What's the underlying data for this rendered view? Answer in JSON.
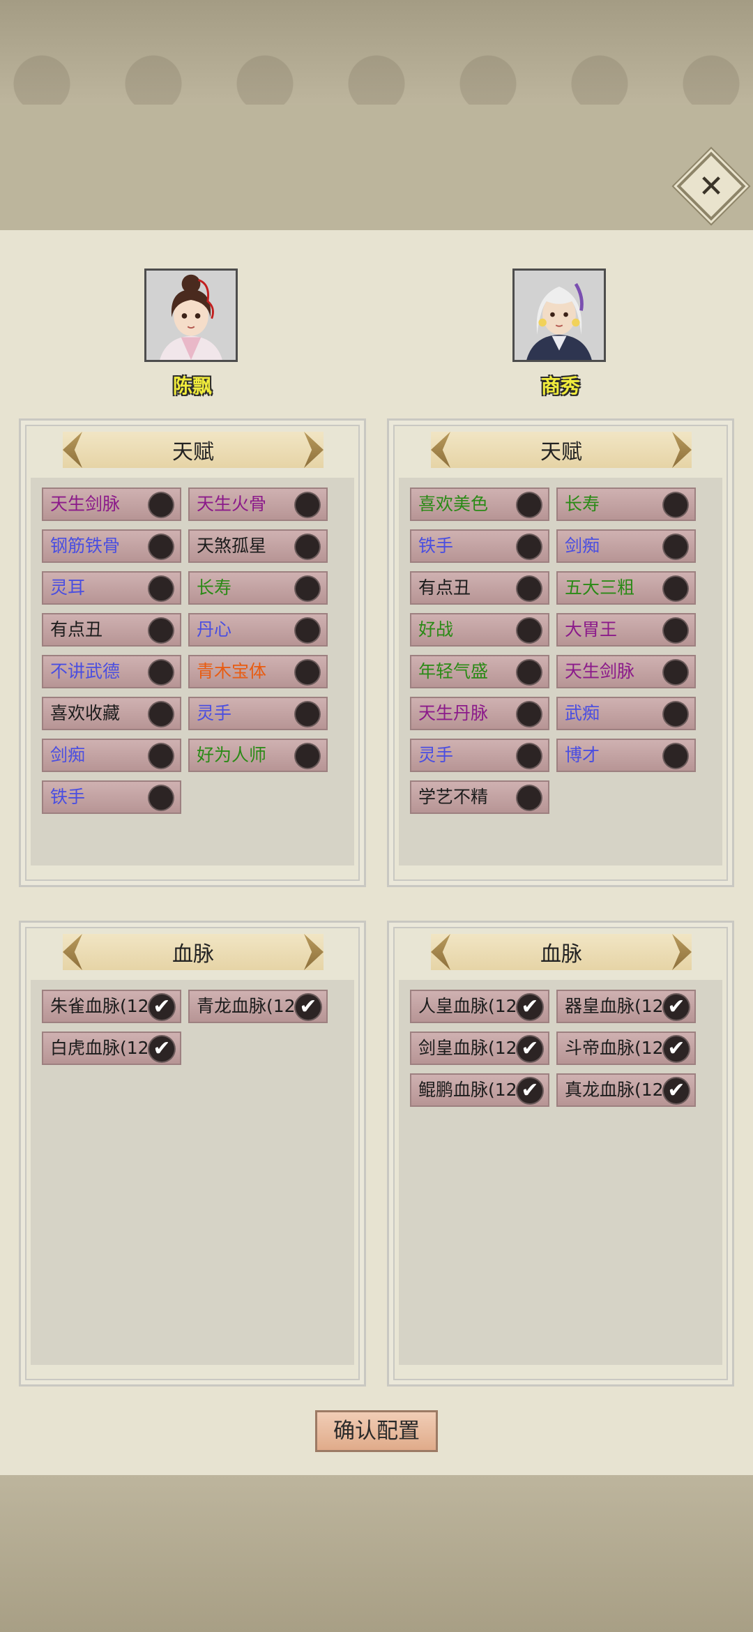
{
  "characters": [
    {
      "name": "陈飘",
      "avatar": "female-hero-portrait"
    },
    {
      "name": "商秀",
      "avatar": "silver-hair-hero-portrait"
    }
  ],
  "talent_title": "天赋",
  "bloodline_title": "血脉",
  "left_talents": [
    {
      "label": "天生剑脉",
      "color": "purple"
    },
    {
      "label": "天生火骨",
      "color": "purple"
    },
    {
      "label": "钢筋铁骨",
      "color": "blue"
    },
    {
      "label": "天煞孤星",
      "color": "black"
    },
    {
      "label": "灵耳",
      "color": "blue"
    },
    {
      "label": "长寿",
      "color": "green"
    },
    {
      "label": "有点丑",
      "color": "black"
    },
    {
      "label": "丹心",
      "color": "blue"
    },
    {
      "label": "不讲武德",
      "color": "blue"
    },
    {
      "label": "青木宝体",
      "color": "orange"
    },
    {
      "label": "喜欢收藏",
      "color": "black"
    },
    {
      "label": "灵手",
      "color": "blue"
    },
    {
      "label": "剑痴",
      "color": "blue"
    },
    {
      "label": "好为人师",
      "color": "green"
    },
    {
      "label": "铁手",
      "color": "blue"
    }
  ],
  "right_talents": [
    {
      "label": "喜欢美色",
      "color": "green"
    },
    {
      "label": "长寿",
      "color": "green"
    },
    {
      "label": "铁手",
      "color": "blue"
    },
    {
      "label": "剑痴",
      "color": "blue"
    },
    {
      "label": "有点丑",
      "color": "black"
    },
    {
      "label": "五大三粗",
      "color": "green"
    },
    {
      "label": "好战",
      "color": "green"
    },
    {
      "label": "大胃王",
      "color": "purple"
    },
    {
      "label": "年轻气盛",
      "color": "green"
    },
    {
      "label": "天生剑脉",
      "color": "purple"
    },
    {
      "label": "天生丹脉",
      "color": "purple"
    },
    {
      "label": "武痴",
      "color": "blue"
    },
    {
      "label": "灵手",
      "color": "blue"
    },
    {
      "label": "博才",
      "color": "blue"
    },
    {
      "label": "学艺不精",
      "color": "black"
    }
  ],
  "left_bloodlines": [
    "朱雀血脉(12",
    "青龙血脉(12",
    "白虎血脉(12"
  ],
  "right_bloodlines": [
    "人皇血脉(12",
    "器皇血脉(12",
    "剑皇血脉(12",
    "斗帝血脉(12",
    "鲲鹏血脉(12",
    "真龙血脉(12"
  ],
  "confirm_label": "确认配置",
  "close_icon": "close-icon",
  "colors": {
    "purple": "#8b1a8a",
    "blue": "#4a4ee0",
    "green": "#2a8a16",
    "black": "#1c1c1c",
    "orange": "#e85c12",
    "name_yellow": "#f1ec3c"
  }
}
